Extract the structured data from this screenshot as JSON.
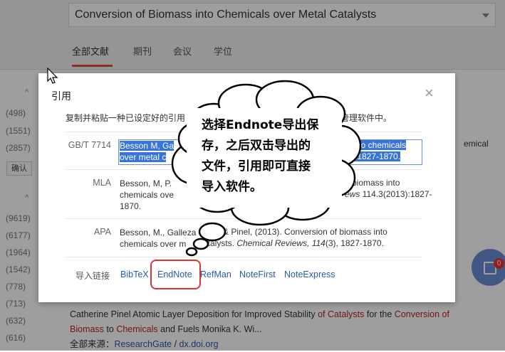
{
  "search": {
    "value": "Conversion of Biomass into Chemicals over Metal Catalysts"
  },
  "tabs": [
    "全部文献",
    "期刊",
    "会议",
    "学位"
  ],
  "sidebar": {
    "counts_top": [
      "(498)",
      "(1551)",
      "(2857)"
    ],
    "confirm": "确认",
    "counts_bottom": [
      "(9619)",
      "(6177)",
      "(1964)",
      "(1542)",
      "(778)",
      "(713)",
      "(632)",
      "(616)"
    ]
  },
  "background": {
    "right_fragment": "emical",
    "tail_fragment": "t.",
    "result_line1_a": "Catherine Pinel Atomic Layer Deposition for Improved Stability ",
    "result_line1_b": "of Catalysts",
    "result_line1_c": " for the ",
    "result_line1_d": "Conversion of",
    "result_line2_a": "Biomass",
    "result_line2_b": " to ",
    "result_line2_c": "Chemicals",
    "result_line2_d": " and Fuels Monika K. Wi...",
    "source_label": "全部来源：",
    "source_1": "ResearchGate",
    "source_sep": " / ",
    "source_2": "dx.doi.org",
    "badge": "0"
  },
  "dialog": {
    "title": "引用",
    "close": "×",
    "instruction_a": "复制并粘贴一种已设定好的引用",
    "instruction_b": "献管理软件中。",
    "gbt_label": "GB/T 7714",
    "gbt_line1_a": "Besson M, Ga",
    "gbt_line1_b": "into chemicals",
    "gbt_line2_a": "over metal c",
    "gbt_line2_b": "):1827-1870.",
    "mla_label": "MLA",
    "mla_line1_a": "Besson, M, P.",
    "mla_line1_b": "biomass into",
    "mla_line2_a": "chemicals ove",
    "mla_line2_b": "ews",
    "mla_line2_c": " 114.3(2013):1827-",
    "mla_line3": "1870.",
    "apa_label": "APA",
    "apa_line1_a": "Besson, M., Galleza",
    "apa_line1_b": "& Pinel,",
    "apa_line1_c": "(2013). Conversion of biomass into",
    "apa_line2_a": "chemicals over m",
    "apa_line2_b": "catalysts. ",
    "apa_line2_c": "Chemical Reviews, 114",
    "apa_line2_d": "(3), 1827-1870.",
    "export_label": "导入链接",
    "export_links": [
      "BibTeX",
      "EndNote",
      "RefMan",
      "NoteFirst",
      "NoteExpress"
    ]
  },
  "callout": {
    "lines": [
      "选择Endnote导出保",
      "存，之后双击导出的",
      "文件，引用即可直接",
      "导入软件。"
    ]
  }
}
